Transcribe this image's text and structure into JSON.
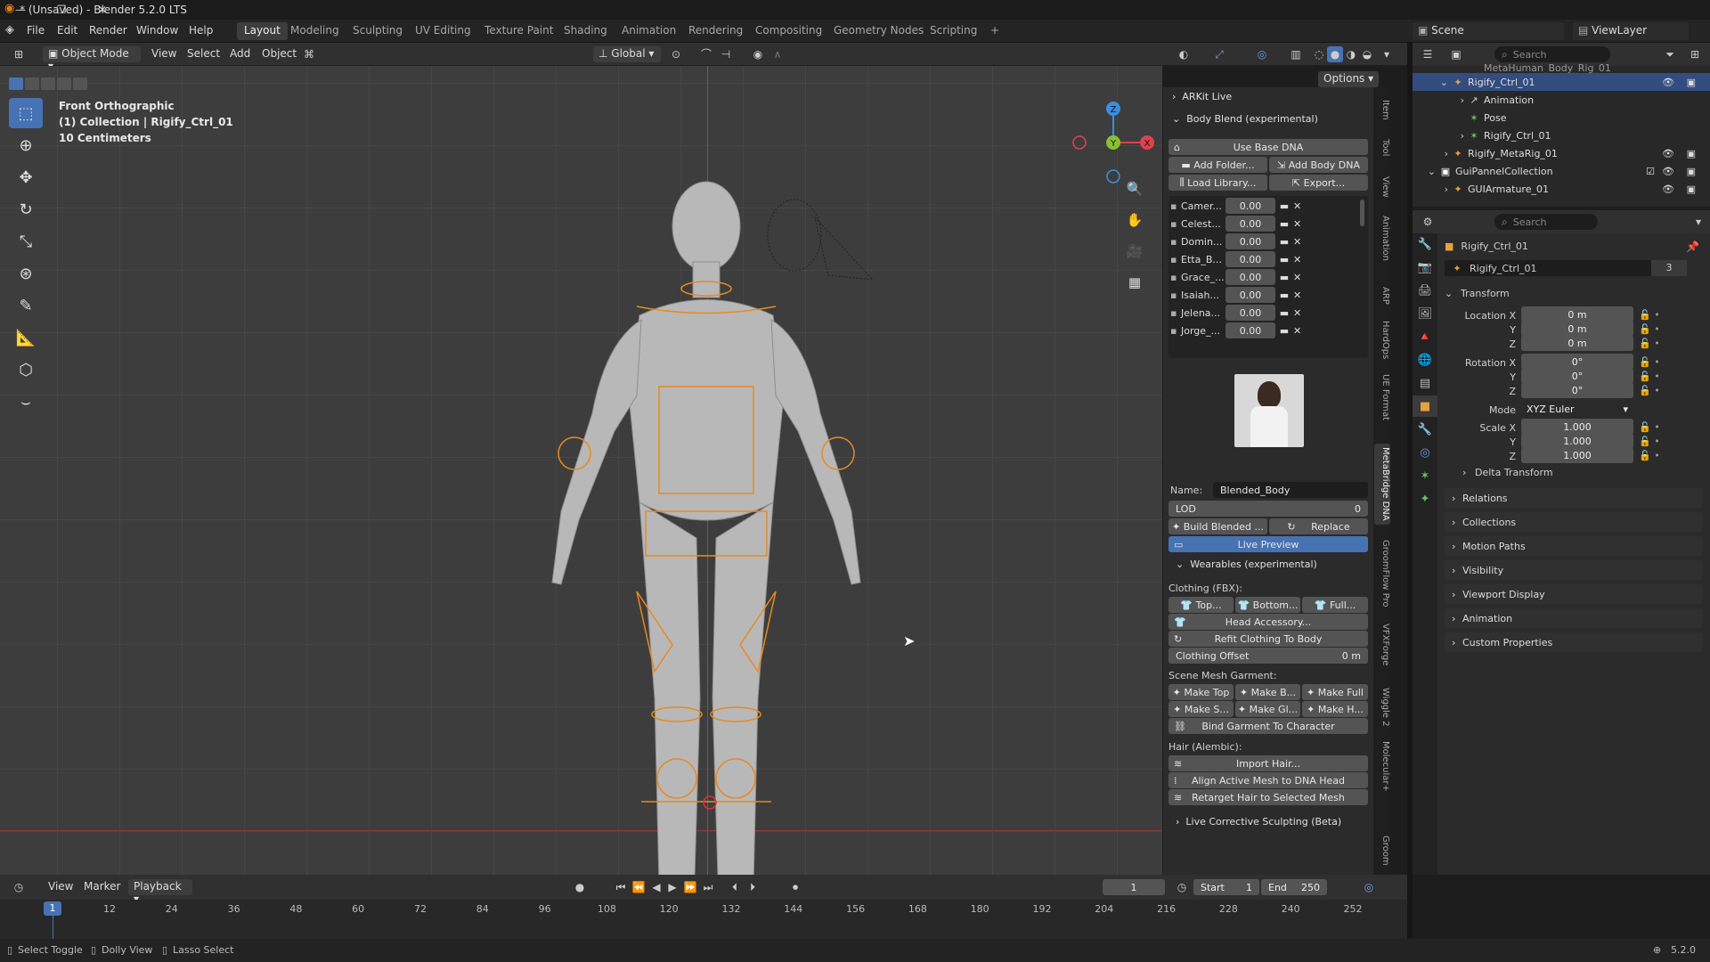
{
  "window": {
    "title": "* (Unsaved) - Blender 5.2.0 LTS"
  },
  "menu": {
    "file": "File",
    "edit": "Edit",
    "render": "Render",
    "window": "Window",
    "help": "Help"
  },
  "workspaces": [
    "Layout",
    "Modeling",
    "Sculpting",
    "UV Editing",
    "Texture Paint",
    "Shading",
    "Animation",
    "Rendering",
    "Compositing",
    "Geometry Nodes",
    "Scripting"
  ],
  "scene": {
    "name": "Scene",
    "view_layer": "ViewLayer"
  },
  "viewport_header": {
    "mode": "Object Mode",
    "view": "View",
    "select": "Select",
    "add": "Add",
    "object": "Object",
    "orientation": "Global",
    "options": "Options"
  },
  "viewport_info": {
    "line1": "Front Orthographic",
    "line2": "(1) Collection | Rigify_Ctrl_01",
    "line3": "10 Centimeters"
  },
  "gizmo": {
    "z": "Z",
    "y": "Y",
    "x": "X"
  },
  "npanel": {
    "arkit": "ARKit Live",
    "body_blend": "Body Blend (experimental)",
    "use_base_dna": "Use Base DNA",
    "add_folder": "Add Folder...",
    "add_body_dna": "Add Body DNA",
    "load_library": "Load Library...",
    "export": "Export...",
    "dna_list": [
      {
        "name": "Camer...",
        "value": "0.00"
      },
      {
        "name": "Celest...",
        "value": "0.00"
      },
      {
        "name": "Domin...",
        "value": "0.00"
      },
      {
        "name": "Etta_B...",
        "value": "0.00"
      },
      {
        "name": "Grace_...",
        "value": "0.00"
      },
      {
        "name": "Isaiah...",
        "value": "0.00"
      },
      {
        "name": "Jelena...",
        "value": "0.00"
      },
      {
        "name": "Jorge_...",
        "value": "0.00"
      }
    ],
    "name_label": "Name:",
    "name_value": "Blended_Body",
    "lod_label": "LOD",
    "lod_value": "0",
    "build_blended": "Build Blended ...",
    "replace": "Replace",
    "live_preview": "Live Preview",
    "wearables": "Wearables (experimental)",
    "clothing_fbx": "Clothing (FBX):",
    "top": "Top...",
    "bottom": "Bottom...",
    "full": "Full...",
    "head_accessory": "Head Accessory...",
    "refit_clothing": "Refit Clothing To Body",
    "clothing_offset_label": "Clothing Offset",
    "clothing_offset_value": "0 m",
    "scene_mesh_garment": "Scene Mesh Garment:",
    "make_top": "Make Top",
    "make_b": "Make B...",
    "make_full": "Make Full",
    "make_s": "Make S...",
    "make_gl": "Make Gl...",
    "make_h": "Make H...",
    "bind_garment": "Bind Garment To Character",
    "hair_alembic": "Hair (Alembic):",
    "import_hair": "Import Hair...",
    "align_mesh": "Align Active Mesh to DNA Head",
    "retarget_hair": "Retarget Hair to Selected Mesh",
    "live_corrective": "Live Corrective Sculpting (Beta)"
  },
  "vertical_tabs": [
    "Item",
    "Tool",
    "View",
    "Animation",
    "ARP",
    "HardOps",
    "UE Format",
    "MetaBridge DNA",
    "GroomFlow Pro",
    "VFXForge",
    "Wiggle 2",
    "Molecular+",
    "Groom"
  ],
  "outliner": {
    "search_placeholder": "Search",
    "rows": [
      {
        "name": "MetaHuman_Body_Rig_01",
        "indent": 4,
        "selected": false
      },
      {
        "name": "Rigify_Ctrl_01",
        "indent": 2,
        "selected": true
      },
      {
        "name": "Animation",
        "indent": 3,
        "selected": false
      },
      {
        "name": "Pose",
        "indent": 3,
        "selected": false
      },
      {
        "name": "Rigify_Ctrl_01",
        "indent": 3,
        "selected": false
      },
      {
        "name": "Rigify_MetaRig_01",
        "indent": 2,
        "selected": false
      },
      {
        "name": "GuiPannelCollection",
        "indent": 1,
        "selected": false
      },
      {
        "name": "GUIArmature_01",
        "indent": 2,
        "selected": false
      }
    ]
  },
  "properties": {
    "search_placeholder": "Search",
    "object_name": "Rigify_Ctrl_01",
    "data_name": "Rigify_Ctrl_01",
    "users": "3",
    "transform": "Transform",
    "location_x_label": "Location X",
    "location_x": "0 m",
    "location_y": "0 m",
    "location_z": "0 m",
    "rotation_x_label": "Rotation X",
    "rotation_x": "0°",
    "rotation_y": "0°",
    "rotation_z": "0°",
    "mode_label": "Mode",
    "mode_value": "XYZ Euler",
    "scale_x_label": "Scale X",
    "scale_x": "1.000",
    "scale_y": "1.000",
    "scale_z": "1.000",
    "y": "Y",
    "z": "Z",
    "delta_transform": "Delta Transform",
    "sections": [
      "Relations",
      "Collections",
      "Motion Paths",
      "Visibility",
      "Viewport Display",
      "Animation",
      "Custom Properties"
    ]
  },
  "timeline": {
    "view": "View",
    "marker": "Marker",
    "playback": "Playback",
    "current_frame": "1",
    "start_label": "Start",
    "start": "1",
    "end_label": "End",
    "end": "250",
    "ticks": [
      "1",
      "12",
      "24",
      "36",
      "48",
      "60",
      "72",
      "84",
      "96",
      "108",
      "120",
      "132",
      "144",
      "156",
      "168",
      "180",
      "192",
      "204",
      "216",
      "228",
      "240",
      "252"
    ]
  },
  "status": {
    "select_toggle": "Select Toggle",
    "dolly_view": "Dolly View",
    "lasso_select": "Lasso Select",
    "version": "5.2.0"
  }
}
